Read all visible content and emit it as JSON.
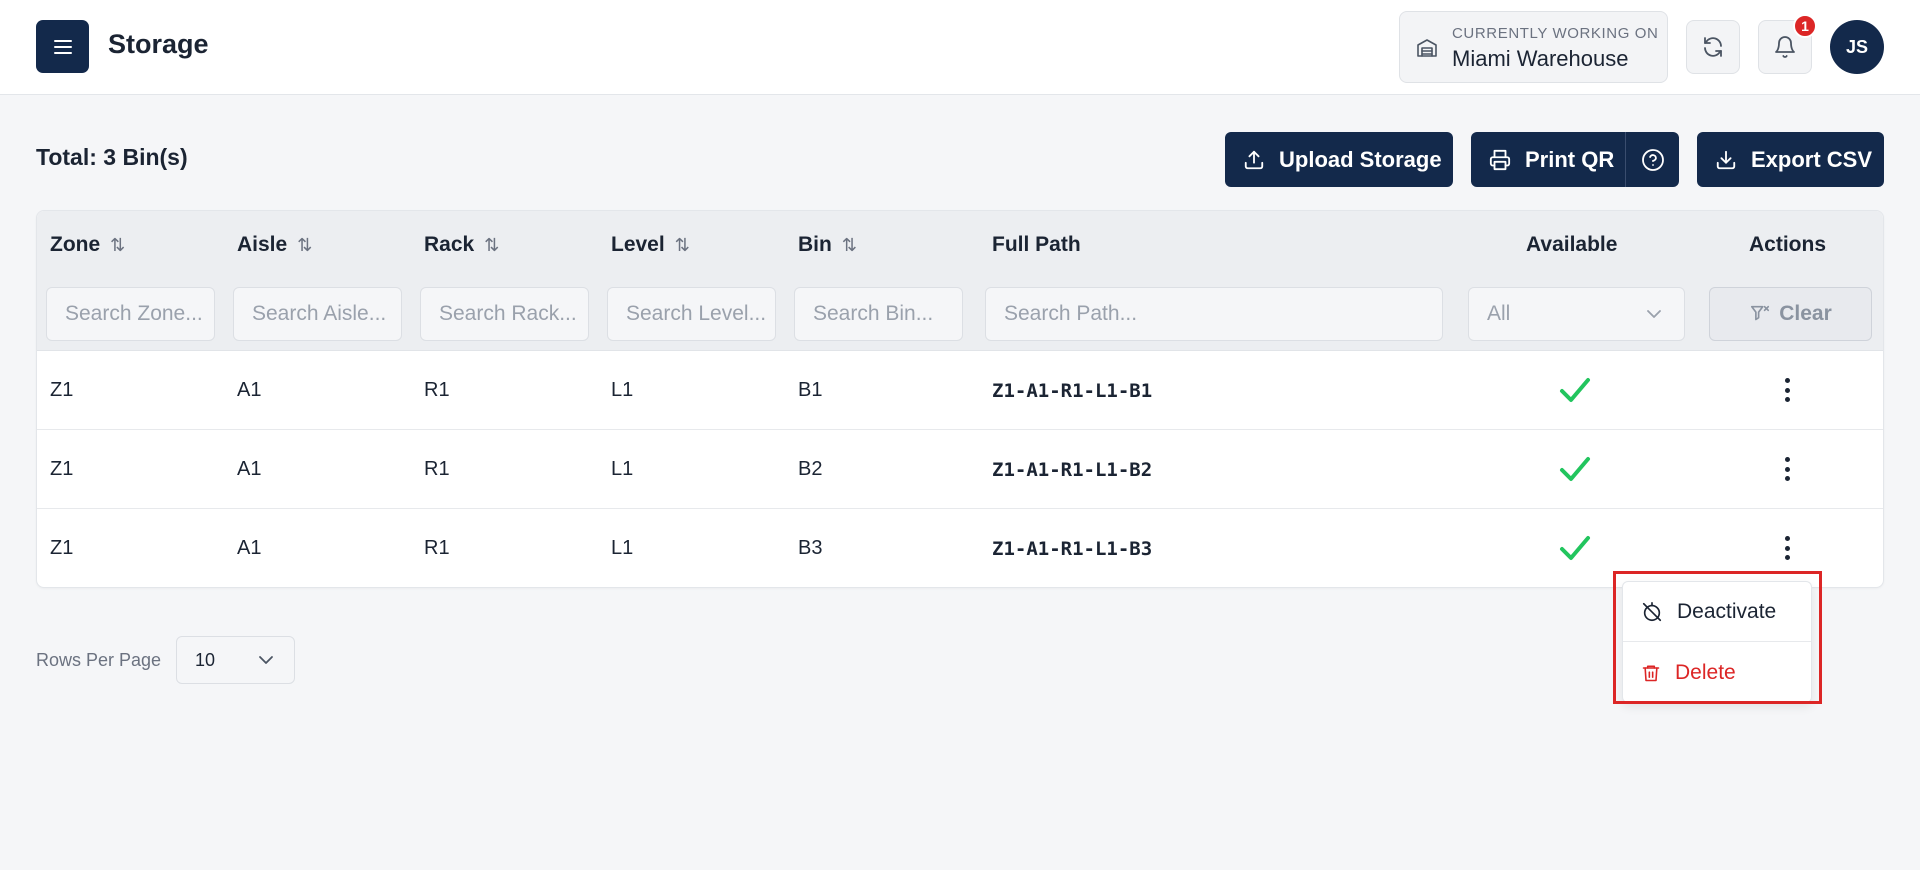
{
  "header": {
    "title": "Storage",
    "working_label": "CURRENTLY WORKING ON",
    "working_value": "Miami Warehouse",
    "notification_count": "1",
    "avatar_initials": "JS"
  },
  "toolbar": {
    "total": "Total: 3 Bin(s)",
    "upload_label": "Upload Storage",
    "print_label": "Print QR",
    "export_label": "Export CSV"
  },
  "table": {
    "columns": {
      "zone": "Zone",
      "aisle": "Aisle",
      "rack": "Rack",
      "level": "Level",
      "bin": "Bin",
      "full_path": "Full Path",
      "available": "Available",
      "actions": "Actions"
    },
    "filters": {
      "zone": "Search Zone...",
      "aisle": "Search Aisle...",
      "rack": "Search Rack...",
      "level": "Search Level...",
      "bin": "Search Bin...",
      "path": "Search Path...",
      "available": "All",
      "clear": "Clear"
    },
    "rows": [
      {
        "zone": "Z1",
        "aisle": "A1",
        "rack": "R1",
        "level": "L1",
        "bin": "B1",
        "path": "Z1-A1-R1-L1-B1",
        "available": true
      },
      {
        "zone": "Z1",
        "aisle": "A1",
        "rack": "R1",
        "level": "L1",
        "bin": "B2",
        "path": "Z1-A1-R1-L1-B2",
        "available": true
      },
      {
        "zone": "Z1",
        "aisle": "A1",
        "rack": "R1",
        "level": "L1",
        "bin": "B3",
        "path": "Z1-A1-R1-L1-B3",
        "available": true
      }
    ]
  },
  "row_menu": {
    "deactivate": "Deactivate",
    "delete": "Delete"
  },
  "pagination": {
    "rows_per_page_label": "Rows Per Page",
    "rows_per_page_value": "10"
  },
  "colors": {
    "primary": "#13294b",
    "success": "#22c55e",
    "danger": "#dc2626"
  }
}
